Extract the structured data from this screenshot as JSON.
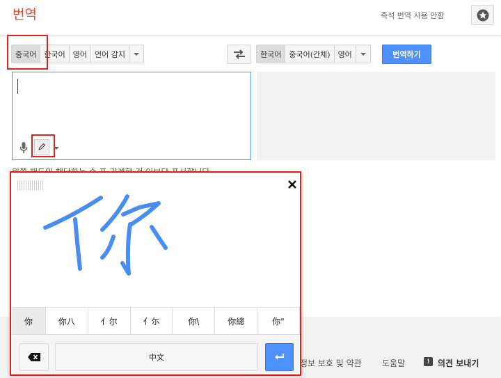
{
  "header": {
    "title": "번역",
    "instant_translate_off": "즉석 번역 사용 안함"
  },
  "source_langs": {
    "items": [
      "중국어",
      "한국어",
      "영어",
      "언어 감지"
    ]
  },
  "target_langs": {
    "items": [
      "한국어",
      "중국어(간체)",
      "영어"
    ]
  },
  "translate_button": "번역하기",
  "hint_text": "왼쪽 패드의 해당하는 수 포 기계한 것 이보단 표시합니다",
  "handwriting": {
    "candidates": [
      "你",
      "你八",
      "亻尔",
      "亻尓",
      "你\\",
      "你總",
      "你\""
    ],
    "space_label": "中文"
  },
  "footer": {
    "privacy": "정보 보호 및 약관",
    "help": "도움말",
    "feedback": "의견 보내기"
  },
  "colors": {
    "accent": "#4d90fe",
    "title": "#dd4b39",
    "ink": "#4a8df0",
    "highlight": "#e0201b"
  }
}
